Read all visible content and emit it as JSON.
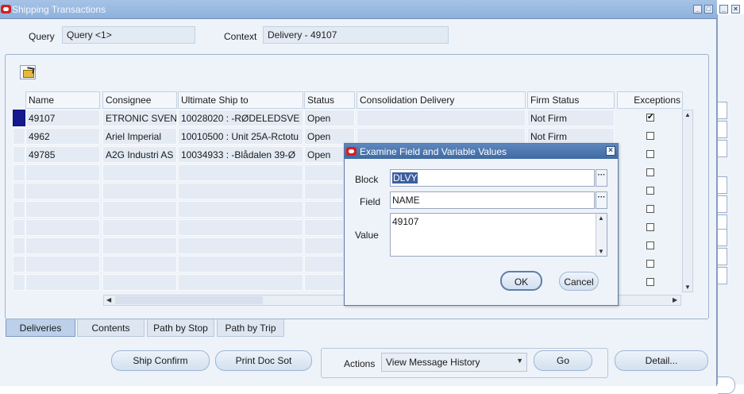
{
  "window": {
    "title": "Shipping Transactions"
  },
  "header": {
    "query_label": "Query",
    "query_value": "Query <1>",
    "context_label": "Context",
    "context_value": "Delivery - 49107"
  },
  "table": {
    "columns": [
      "Name",
      "Consignee",
      "Ultimate Ship to",
      "Status",
      "Consolidation Delivery",
      "Firm Status",
      "Exceptions"
    ],
    "rows": [
      {
        "name": "49107",
        "consignee": "ETRONIC SVEN",
        "ship_to": "10028020 :  -RØDELEDSVE",
        "status": "Open",
        "consolidation": "",
        "firm_status": "Not Firm",
        "exceptions": true
      },
      {
        "name": "4962",
        "consignee": "Ariel Imperial",
        "ship_to": "10010500 : Unit 25A-Rctotu",
        "status": "Open",
        "consolidation": "",
        "firm_status": "Not Firm",
        "exceptions": false
      },
      {
        "name": "49785",
        "consignee": "A2G Industri AS",
        "ship_to": "10034933 :  -Blådalen 39-Ø",
        "status": "Open",
        "consolidation": "",
        "firm_status": "",
        "exceptions": false
      }
    ]
  },
  "tabs": [
    "Deliveries",
    "Contents",
    "Path by Stop",
    "Path by Trip"
  ],
  "footer": {
    "ship_confirm": "Ship Confirm",
    "print_doc_set": "Print Doc Sot",
    "actions_label": "Actions",
    "actions_value": "View Message History",
    "go": "Go",
    "detail": "Detail..."
  },
  "dialog": {
    "title": "Examine Field and Variable Values",
    "block_label": "Block",
    "block_value": "DLVY",
    "field_label": "Field",
    "field_value": "NAME",
    "value_label": "Value",
    "value_value": "49107",
    "ok": "OK",
    "cancel": "Cancel"
  },
  "colors": {
    "title_bar": "#8eb1dc",
    "dialog_title": "#3f6aa3",
    "selected_row_marker": "#14198f",
    "oracle_red": "#d42020"
  }
}
